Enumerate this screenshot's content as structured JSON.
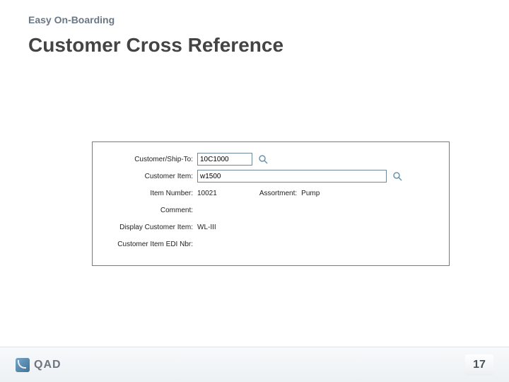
{
  "header": {
    "pretitle": "Easy On-Boarding",
    "title": "Customer Cross Reference"
  },
  "form": {
    "customer_ship_to": {
      "label": "Customer/Ship-To:",
      "value": "10C1000"
    },
    "customer_item": {
      "label": "Customer Item:",
      "value": "w1500"
    },
    "item_number": {
      "label": "Item Number:",
      "value": "10021"
    },
    "assortment": {
      "label": "Assortment:",
      "value": "Pump"
    },
    "comment": {
      "label": "Comment:",
      "value": ""
    },
    "display_customer_item": {
      "label": "Display Customer Item:",
      "value": "WL-III"
    },
    "customer_item_edi_nbr": {
      "label": "Customer Item EDI Nbr:",
      "value": ""
    }
  },
  "footer": {
    "brand": "QAD",
    "page_number": "17"
  }
}
